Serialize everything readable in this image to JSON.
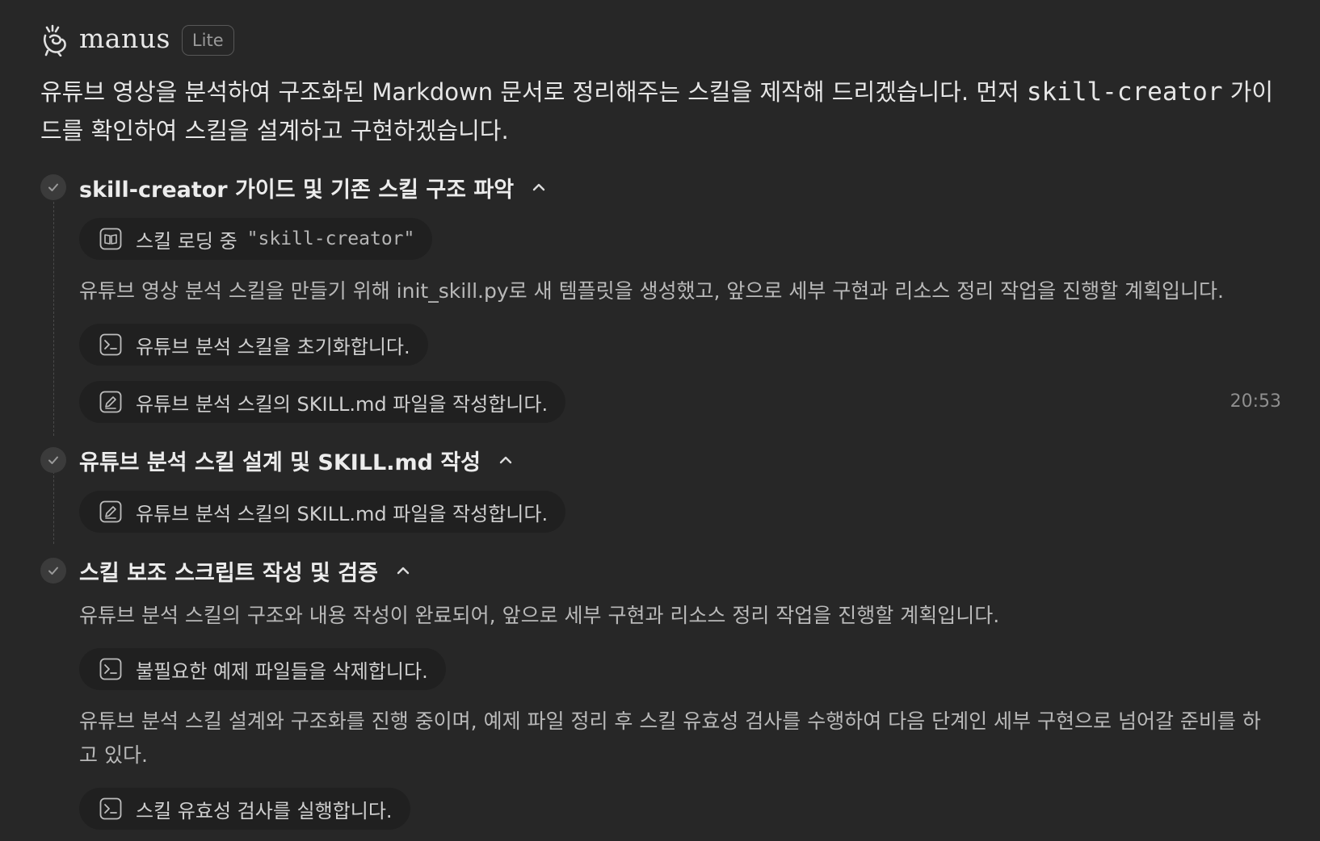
{
  "app": {
    "brand": "manus",
    "tier_badge": "Lite"
  },
  "intro": {
    "text_before": "유튜브 영상을 분석하여 구조화된 Markdown 문서로 정리해주는 스킬을 제작해 드리겠습니다. 먼저 ",
    "code": "skill-creator",
    "text_after": " 가이드를 확인하여 스킬을 설계하고 구현하겠습니다."
  },
  "sections": [
    {
      "title": "skill-creator 가이드 및 기존 스킬 구조 파악",
      "steps": [
        {
          "icon": "book-icon",
          "label": "스킬 로딩 중",
          "code": "\"skill-creator\""
        },
        {
          "paragraph": "유튜브 영상 분석 스킬을 만들기 위해 init_skill.py로 새 템플릿을 생성했고, 앞으로 세부 구현과 리소스 정리 작업을 진행할 계획입니다."
        },
        {
          "icon": "terminal-icon",
          "label": "유튜브 분석 스킬을 초기화합니다."
        },
        {
          "icon": "edit-icon",
          "label": "유튜브 분석 스킬의 SKILL.md 파일을 작성합니다.",
          "time": "20:53"
        }
      ]
    },
    {
      "title": "유튜브 분석 스킬 설계 및 SKILL.md 작성",
      "steps": [
        {
          "icon": "edit-icon",
          "label": "유튜브 분석 스킬의 SKILL.md 파일을 작성합니다."
        }
      ]
    },
    {
      "title": "스킬 보조 스크립트 작성 및 검증",
      "steps": [
        {
          "paragraph": "유튜브 분석 스킬의 구조와 내용 작성이 완료되어, 앞으로 세부 구현과 리소스 정리 작업을 진행할 계획입니다."
        },
        {
          "icon": "terminal-icon",
          "label": "불필요한 예제 파일들을 삭제합니다."
        },
        {
          "paragraph": "유튜브 분석 스킬 설계와 구조화를 진행 중이며, 예제 파일 정리 후 스킬 유효성 검사를 수행하여 다음 단계인 세부 구현으로 넘어갈 준비를 하고 있다."
        },
        {
          "icon": "terminal-icon",
          "label": "스킬 유효성 검사를 실행합니다."
        }
      ]
    }
  ],
  "colors": {
    "background": "#272727",
    "pill_background": "#202020",
    "check_background": "#3b3b3b"
  }
}
